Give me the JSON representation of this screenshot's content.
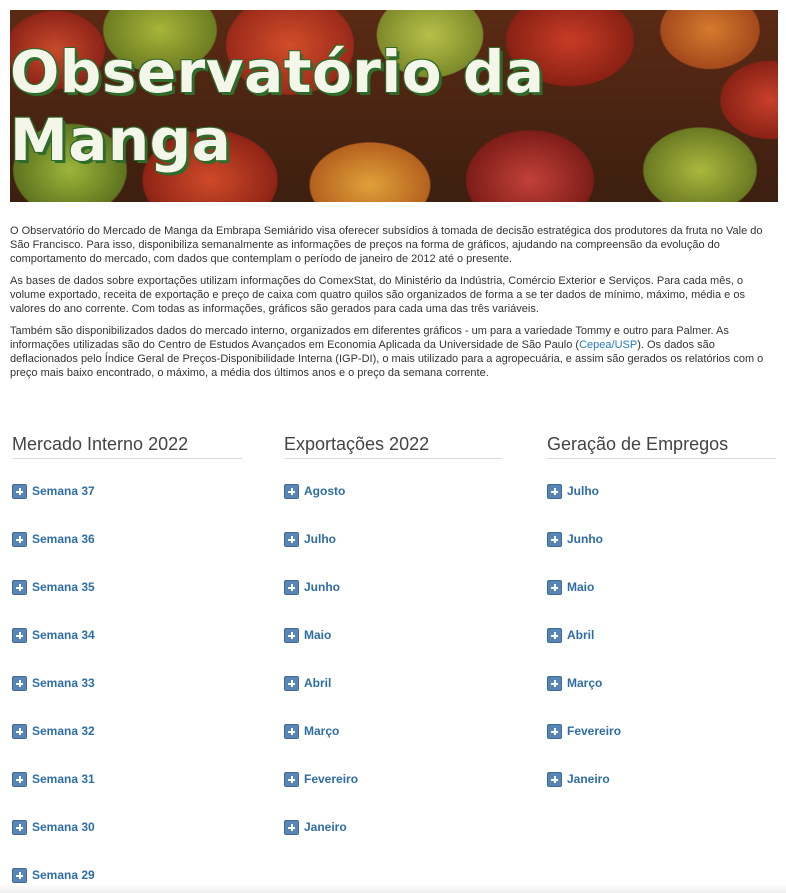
{
  "banner": {
    "title": "Observatório da Manga"
  },
  "intro": {
    "p1": "O Observatório do Mercado de Manga da Embrapa Semiárido visa oferecer subsídios à tomada de decisão estratégica dos produtores da fruta no Vale do São Francisco. Para isso, disponibiliza semanalmente as informações de preços na forma de gráficos, ajudando na compreensão da evolução do comportamento do mercado, com dados que contemplam o período de janeiro de 2012 até o presente.",
    "p2": "As bases de dados sobre exportações utilizam informações do ComexStat, do Ministério da Indústria, Comércio Exterior e Serviços. Para cada mês, o volume exportado, receita de exportação e preço de caixa com quatro quilos são organizados de forma a se ter dados de mínimo, máximo, média e os valores do ano corrente. Com todas as informações, gráficos são gerados para cada uma das três variáveis.",
    "p3_before": "Também são disponibilizados dados do mercado interno, organizados em diferentes gráficos - um para a variedade Tommy e outro para Palmer.  As informações utilizadas são do Centro de Estudos Avançados em Economia Aplicada da Universidade de São Paulo (",
    "p3_link": "Cepea/USP",
    "p3_after": "). Os dados são deflacionados pelo Índice Geral de Preços-Disponibilidade Interna (IGP-DI), o mais utilizado para a agropecuária, e assim são gerados os relatórios com o preço mais baixo encontrado, o máximo, a média dos últimos anos e o preço da semana corrente."
  },
  "columns": [
    {
      "heading": "Mercado Interno 2022",
      "items": [
        "Semana 37",
        "Semana 36",
        "Semana 35",
        "Semana 34",
        "Semana 33",
        "Semana 32",
        "Semana 31",
        "Semana 30",
        "Semana 29"
      ]
    },
    {
      "heading": "Exportações 2022",
      "items": [
        "Agosto",
        "Julho",
        "Junho",
        "Maio",
        "Abril",
        "Março",
        "Fevereiro",
        "Janeiro"
      ]
    },
    {
      "heading": "Geração de Empregos",
      "items": [
        "Julho",
        "Junho",
        "Maio",
        "Abril",
        "Março",
        "Fevereiro",
        "Janeiro"
      ]
    }
  ],
  "colors": {
    "link": "#2e6da4",
    "icon": "#5a86b5",
    "title_shadow": "#2f6b2a"
  },
  "icons": {
    "list_item": "plus-square-icon"
  }
}
